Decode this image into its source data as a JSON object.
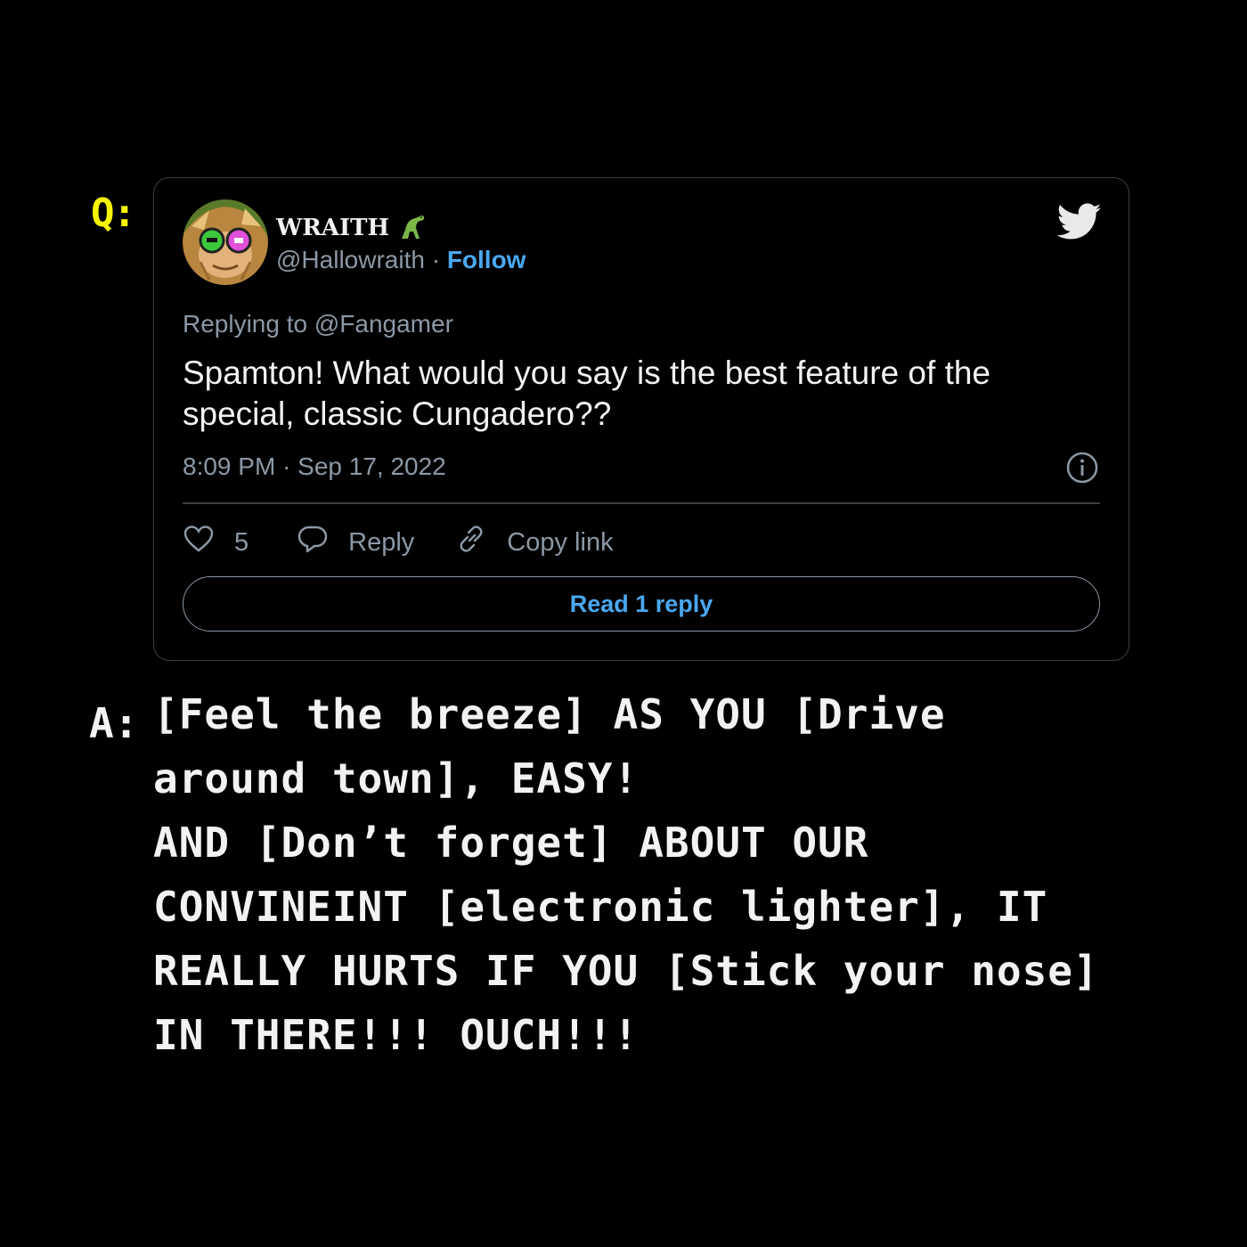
{
  "question": {
    "label": "Q:"
  },
  "tweet": {
    "author_name": "WRAITH",
    "author_emoji_icon": "dinosaur-icon",
    "handle": "@Hallowraith",
    "separator": "·",
    "follow_label": "Follow",
    "replying_to": "Replying to @Fangamer",
    "text": "Spamton! What would you say is the best feature of the special, classic Cungadero??",
    "timestamp": "8:09 PM · Sep 17, 2022",
    "like_count": "5",
    "reply_label": "Reply",
    "copy_link_label": "Copy link",
    "read_reply_label": "Read 1 reply",
    "colors": {
      "accent": "#4aa8f0",
      "muted": "#8b98a5",
      "border": "#3a3f44"
    }
  },
  "answer": {
    "label": "A:",
    "lines": [
      "[Feel the breeze] AS YOU [Drive",
      "around town], EASY!",
      "AND [Don’t forget] ABOUT OUR",
      "CONVINEINT [electronic lighter], IT",
      "REALLY HURTS IF YOU [Stick your nose]",
      "IN THERE!!! OUCH!!!"
    ]
  },
  "colors": {
    "background": "#000000",
    "q_label": "#f5f500",
    "text": "#f2f2f2"
  }
}
